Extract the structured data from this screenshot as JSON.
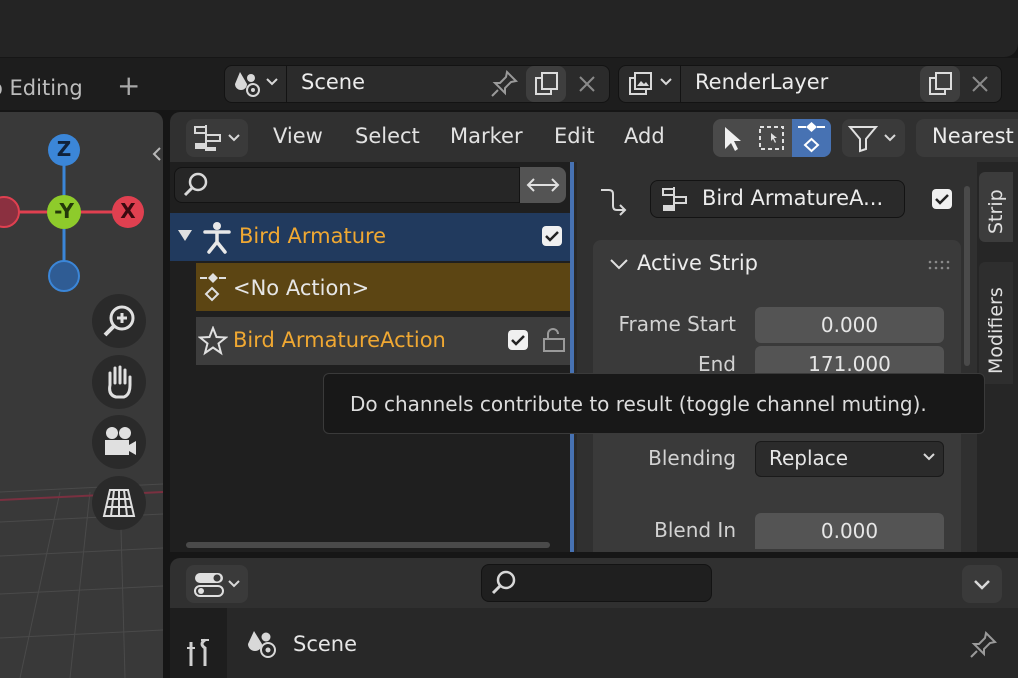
{
  "workspace": {
    "tab_label": "o Editing",
    "add_label": "+"
  },
  "scene_selector": {
    "value": "Scene"
  },
  "layer_selector": {
    "value": "RenderLayer"
  },
  "nla_header": {
    "menus": [
      "View",
      "Select",
      "Marker",
      "Edit",
      "Add"
    ],
    "snap_value": "Nearest"
  },
  "channels": {
    "object": {
      "name": "Bird Armature",
      "checked": true
    },
    "action_strip": {
      "name": "<No Action>"
    },
    "action_track": {
      "name": "Bird ArmatureAction",
      "checked": true
    }
  },
  "sidebar": {
    "strip_name": "Bird ArmatureA...",
    "strip_checked": true,
    "panel_title": "Active Strip",
    "frame_start_label": "Frame Start",
    "frame_start_value": "0.000",
    "end_label": "End",
    "end_value": "171.000",
    "blending_label": "Blending",
    "blending_value": "Replace",
    "blend_in_label": "Blend In",
    "blend_in_value": "0.000",
    "tabs": [
      "Strip",
      "Modifiers"
    ]
  },
  "tooltip": {
    "text": "Do channels contribute to result (toggle channel muting)."
  },
  "gizmo": {
    "z": "Z",
    "y": "-Y",
    "x": "X"
  },
  "properties": {
    "scene_label": "Scene"
  },
  "colors": {
    "accent_orange": "#f0a832",
    "selection_blue": "#4772b3",
    "strip_brown": "#5c4513",
    "axis_x": "#e04050",
    "axis_y": "#8ecb2b",
    "axis_z": "#3b86d8"
  }
}
